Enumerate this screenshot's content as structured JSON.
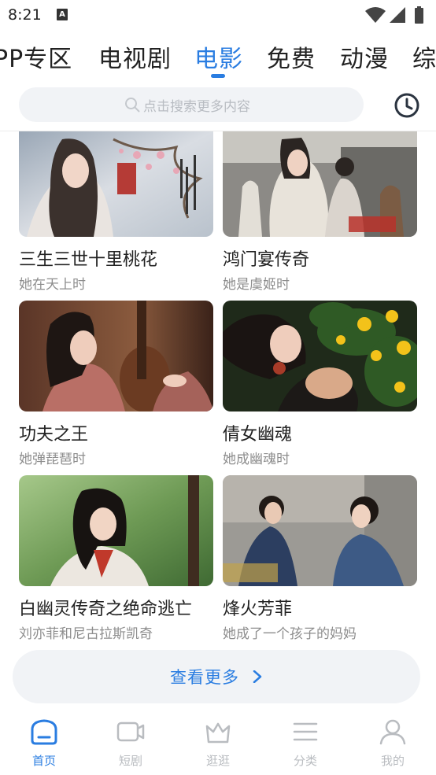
{
  "status_bar": {
    "time": "8:21",
    "notification_glyph": "A"
  },
  "top_tabs": [
    {
      "label": "PP专区",
      "active": false
    },
    {
      "label": "电视剧",
      "active": false
    },
    {
      "label": "电影",
      "active": true
    },
    {
      "label": "免费",
      "active": false
    },
    {
      "label": "动漫",
      "active": false
    },
    {
      "label": "综",
      "active": false
    }
  ],
  "search": {
    "placeholder": "点击搜索更多内容",
    "history_icon": "clock-icon"
  },
  "cards": [
    {
      "title": "三生三世十里桃花",
      "subtitle": "她在天上时"
    },
    {
      "title": "鸿门宴传奇",
      "subtitle": "她是虞姬时"
    },
    {
      "title": "功夫之王",
      "subtitle": "她弹琵琶时"
    },
    {
      "title": "倩女幽魂",
      "subtitle": "她成幽魂时"
    },
    {
      "title": "白幽灵传奇之绝命逃亡",
      "subtitle": "刘亦菲和尼古拉斯凯奇"
    },
    {
      "title": "烽火芳菲",
      "subtitle": "她成了一个孩子的妈妈"
    }
  ],
  "more_button": {
    "label": "查看更多"
  },
  "bottom_nav": [
    {
      "label": "首页",
      "icon": "home-icon",
      "active": true
    },
    {
      "label": "短剧",
      "icon": "video-icon",
      "active": false
    },
    {
      "label": "逛逛",
      "icon": "crown-icon",
      "active": false
    },
    {
      "label": "分类",
      "icon": "menu-icon",
      "active": false
    },
    {
      "label": "我的",
      "icon": "profile-icon",
      "active": false
    }
  ],
  "colors": {
    "accent": "#2a7de1",
    "inactive": "#b9bcc0",
    "search_bg": "#f1f3f6"
  }
}
